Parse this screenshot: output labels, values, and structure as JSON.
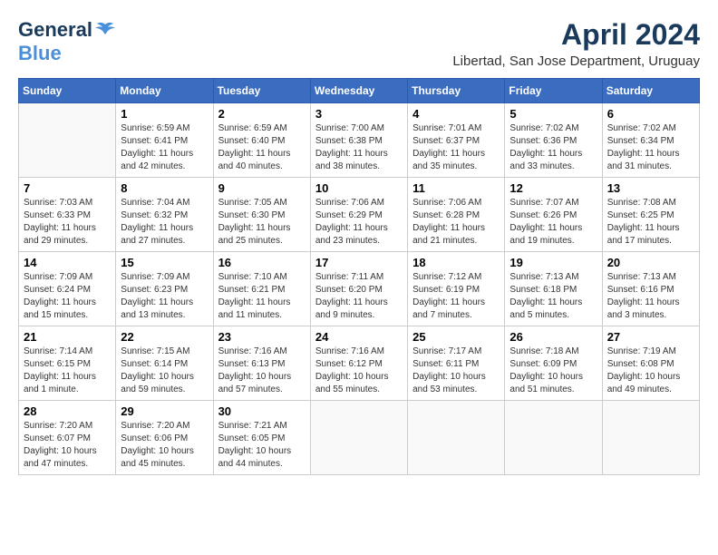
{
  "app": {
    "logo_general": "General",
    "logo_blue": "Blue"
  },
  "header": {
    "month": "April 2024",
    "location": "Libertad, San Jose Department, Uruguay"
  },
  "weekdays": [
    "Sunday",
    "Monday",
    "Tuesday",
    "Wednesday",
    "Thursday",
    "Friday",
    "Saturday"
  ],
  "weeks": [
    [
      {
        "day": "",
        "info": ""
      },
      {
        "day": "1",
        "info": "Sunrise: 6:59 AM\nSunset: 6:41 PM\nDaylight: 11 hours\nand 42 minutes."
      },
      {
        "day": "2",
        "info": "Sunrise: 6:59 AM\nSunset: 6:40 PM\nDaylight: 11 hours\nand 40 minutes."
      },
      {
        "day": "3",
        "info": "Sunrise: 7:00 AM\nSunset: 6:38 PM\nDaylight: 11 hours\nand 38 minutes."
      },
      {
        "day": "4",
        "info": "Sunrise: 7:01 AM\nSunset: 6:37 PM\nDaylight: 11 hours\nand 35 minutes."
      },
      {
        "day": "5",
        "info": "Sunrise: 7:02 AM\nSunset: 6:36 PM\nDaylight: 11 hours\nand 33 minutes."
      },
      {
        "day": "6",
        "info": "Sunrise: 7:02 AM\nSunset: 6:34 PM\nDaylight: 11 hours\nand 31 minutes."
      }
    ],
    [
      {
        "day": "7",
        "info": "Sunrise: 7:03 AM\nSunset: 6:33 PM\nDaylight: 11 hours\nand 29 minutes."
      },
      {
        "day": "8",
        "info": "Sunrise: 7:04 AM\nSunset: 6:32 PM\nDaylight: 11 hours\nand 27 minutes."
      },
      {
        "day": "9",
        "info": "Sunrise: 7:05 AM\nSunset: 6:30 PM\nDaylight: 11 hours\nand 25 minutes."
      },
      {
        "day": "10",
        "info": "Sunrise: 7:06 AM\nSunset: 6:29 PM\nDaylight: 11 hours\nand 23 minutes."
      },
      {
        "day": "11",
        "info": "Sunrise: 7:06 AM\nSunset: 6:28 PM\nDaylight: 11 hours\nand 21 minutes."
      },
      {
        "day": "12",
        "info": "Sunrise: 7:07 AM\nSunset: 6:26 PM\nDaylight: 11 hours\nand 19 minutes."
      },
      {
        "day": "13",
        "info": "Sunrise: 7:08 AM\nSunset: 6:25 PM\nDaylight: 11 hours\nand 17 minutes."
      }
    ],
    [
      {
        "day": "14",
        "info": "Sunrise: 7:09 AM\nSunset: 6:24 PM\nDaylight: 11 hours\nand 15 minutes."
      },
      {
        "day": "15",
        "info": "Sunrise: 7:09 AM\nSunset: 6:23 PM\nDaylight: 11 hours\nand 13 minutes."
      },
      {
        "day": "16",
        "info": "Sunrise: 7:10 AM\nSunset: 6:21 PM\nDaylight: 11 hours\nand 11 minutes."
      },
      {
        "day": "17",
        "info": "Sunrise: 7:11 AM\nSunset: 6:20 PM\nDaylight: 11 hours\nand 9 minutes."
      },
      {
        "day": "18",
        "info": "Sunrise: 7:12 AM\nSunset: 6:19 PM\nDaylight: 11 hours\nand 7 minutes."
      },
      {
        "day": "19",
        "info": "Sunrise: 7:13 AM\nSunset: 6:18 PM\nDaylight: 11 hours\nand 5 minutes."
      },
      {
        "day": "20",
        "info": "Sunrise: 7:13 AM\nSunset: 6:16 PM\nDaylight: 11 hours\nand 3 minutes."
      }
    ],
    [
      {
        "day": "21",
        "info": "Sunrise: 7:14 AM\nSunset: 6:15 PM\nDaylight: 11 hours\nand 1 minute."
      },
      {
        "day": "22",
        "info": "Sunrise: 7:15 AM\nSunset: 6:14 PM\nDaylight: 10 hours\nand 59 minutes."
      },
      {
        "day": "23",
        "info": "Sunrise: 7:16 AM\nSunset: 6:13 PM\nDaylight: 10 hours\nand 57 minutes."
      },
      {
        "day": "24",
        "info": "Sunrise: 7:16 AM\nSunset: 6:12 PM\nDaylight: 10 hours\nand 55 minutes."
      },
      {
        "day": "25",
        "info": "Sunrise: 7:17 AM\nSunset: 6:11 PM\nDaylight: 10 hours\nand 53 minutes."
      },
      {
        "day": "26",
        "info": "Sunrise: 7:18 AM\nSunset: 6:09 PM\nDaylight: 10 hours\nand 51 minutes."
      },
      {
        "day": "27",
        "info": "Sunrise: 7:19 AM\nSunset: 6:08 PM\nDaylight: 10 hours\nand 49 minutes."
      }
    ],
    [
      {
        "day": "28",
        "info": "Sunrise: 7:20 AM\nSunset: 6:07 PM\nDaylight: 10 hours\nand 47 minutes."
      },
      {
        "day": "29",
        "info": "Sunrise: 7:20 AM\nSunset: 6:06 PM\nDaylight: 10 hours\nand 45 minutes."
      },
      {
        "day": "30",
        "info": "Sunrise: 7:21 AM\nSunset: 6:05 PM\nDaylight: 10 hours\nand 44 minutes."
      },
      {
        "day": "",
        "info": ""
      },
      {
        "day": "",
        "info": ""
      },
      {
        "day": "",
        "info": ""
      },
      {
        "day": "",
        "info": ""
      }
    ]
  ]
}
